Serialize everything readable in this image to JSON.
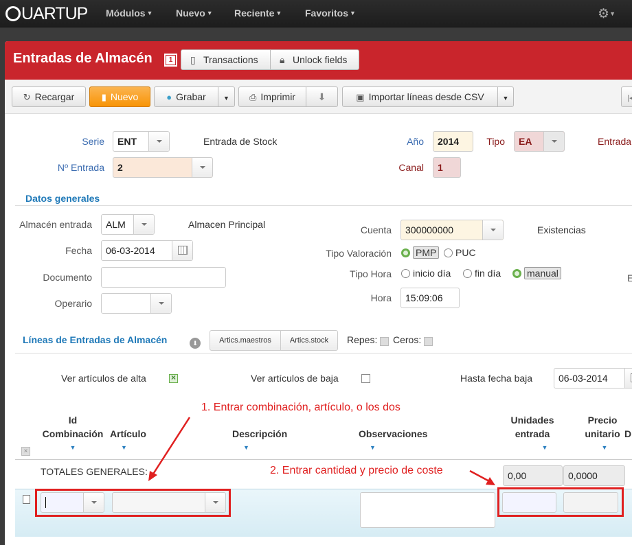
{
  "topbar": {
    "logo": "QUARTUP",
    "menu": [
      "Módulos",
      "Nuevo",
      "Reciente",
      "Favoritos"
    ],
    "settings_icon": "gear-icon"
  },
  "header": {
    "title": "Entradas de Almacén",
    "badge": "1",
    "transactions_label": "Transactions",
    "unlock_label": "Unlock fields"
  },
  "toolbar": {
    "reload": "Recargar",
    "new": "Nuevo",
    "save": "Grabar",
    "print": "Imprimir",
    "import_csv": "Importar líneas desde CSV"
  },
  "form": {
    "serie_label": "Serie",
    "serie_value": "ENT",
    "serie_desc": "Entrada de Stock",
    "ano_label": "Año",
    "ano_value": "2014",
    "tipo_label": "Tipo",
    "tipo_value": "EA",
    "entrada_label": "Entrada",
    "nentrada_label": "Nº Entrada",
    "nentrada_value": "2",
    "canal_label": "Canal",
    "canal_value": "1"
  },
  "general": {
    "section_title": "Datos generales",
    "almacen_label": "Almacén entrada",
    "almacen_value": "ALM",
    "almacen_desc": "Almacen Principal",
    "fecha_label": "Fecha",
    "fecha_value": "06-03-2014",
    "documento_label": "Documento",
    "documento_value": "",
    "operario_label": "Operario",
    "operario_value": "",
    "cuenta_label": "Cuenta",
    "cuenta_value": "300000000",
    "existencias": "Existencias",
    "valoracion_label": "Tipo Valoración",
    "valoracion_options": [
      "PMP",
      "PUC"
    ],
    "valoracion_selected": "PMP",
    "hora_tipo_label": "Tipo Hora",
    "hora_tipo_options": [
      "inicio día",
      "fin día",
      "manual"
    ],
    "hora_tipo_selected": "manual",
    "hora_label": "Hora",
    "hora_value": "15:09:06",
    "cut_e": "E"
  },
  "lines": {
    "section_title": "Líneas de Entradas de Almacén",
    "btn_maestros": "Artics.maestros",
    "btn_stock": "Artics.stock",
    "repes_label": "Repes:",
    "ceros_label": "Ceros:",
    "ver_alta_label": "Ver artículos de alta",
    "ver_alta_checked": true,
    "ver_baja_label": "Ver artículos de baja",
    "ver_baja_checked": false,
    "hasta_label": "Hasta fecha baja",
    "hasta_value": "06-03-2014",
    "columns": {
      "id_comb_1": "Id",
      "id_comb_2": "Combinación",
      "articulo": "Artículo",
      "descripcion": "Descripción",
      "observaciones": "Observaciones",
      "unidades_1": "Unidades",
      "unidades_2": "entrada",
      "precio_1": "Precio",
      "precio_2": "unitario",
      "cut_d": "D"
    },
    "totals_label": "TOTALES GENERALES:",
    "total_unidades": "0,00",
    "total_precio": "0,0000"
  },
  "annotations": {
    "note1": "1. Entrar combinación, artículo, o los dos",
    "note2": "2. Entrar cantidad y precio de coste",
    "color": "#e02020"
  },
  "colors": {
    "header_red": "#c9252c",
    "accent_orange": "#f89406",
    "section_blue": "#1f79b8"
  }
}
